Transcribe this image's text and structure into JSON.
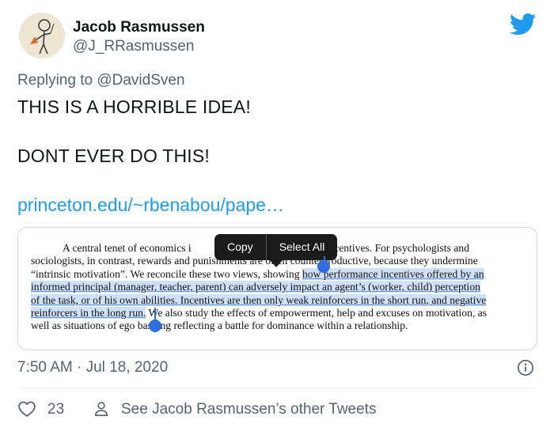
{
  "author": {
    "name": "Jacob Rasmussen",
    "handle": "@J_RRasmussen"
  },
  "reply": {
    "prefix": "Replying to",
    "mention": "@DavidSven"
  },
  "tweet": {
    "line1": "THIS IS A HORRIBLE IDEA!",
    "line2": "DONT EVER DO THIS!",
    "link": "princeton.edu/~rbenabou/pape…"
  },
  "card": {
    "lines": [
      {
        "pre": "A central tenet of economics i",
        "post": "to incentives. For psychologists and"
      },
      {
        "text": "sociologists, in contrast, rewards and punishments are often counterproductive, because they undermine"
      },
      {
        "pre": "“intrinsic motivation”. We reconcile these two views, showing ",
        "hl": "how performance incentives offered by an"
      },
      {
        "hl": "informed principal (manager, teacher, parent) can adversely impact an agent’s (worker, child) perception"
      },
      {
        "hl": "of the task, or of his own abilities. Incentives are then only weak reinforcers in the short run, and negative"
      },
      {
        "hl": "reinforcers in the long run.",
        "post": " We also study the effects of empowerment, help and excuses on motivation, as"
      },
      {
        "text": "well as situations of ego bashing reflecting a battle for dominance within a relationship."
      }
    ],
    "popup": {
      "copy": "Copy",
      "select_all": "Select All"
    }
  },
  "meta": {
    "time": "7:50 AM",
    "separator": "·",
    "date": "Jul 18, 2020"
  },
  "actions": {
    "likes": "23",
    "other_tweets": "See Jacob Rasmussen’s other Tweets"
  },
  "colors": {
    "link": "#1d9bf0",
    "secondary_text": "#536471",
    "selection": "#cfe1f7",
    "selection_handle": "#2f6fe0",
    "twitter_blue": "#1d9bf0"
  },
  "icons": {
    "brand": "twitter-bird-icon",
    "info": "info-icon",
    "like": "heart-icon",
    "profile": "person-icon"
  }
}
